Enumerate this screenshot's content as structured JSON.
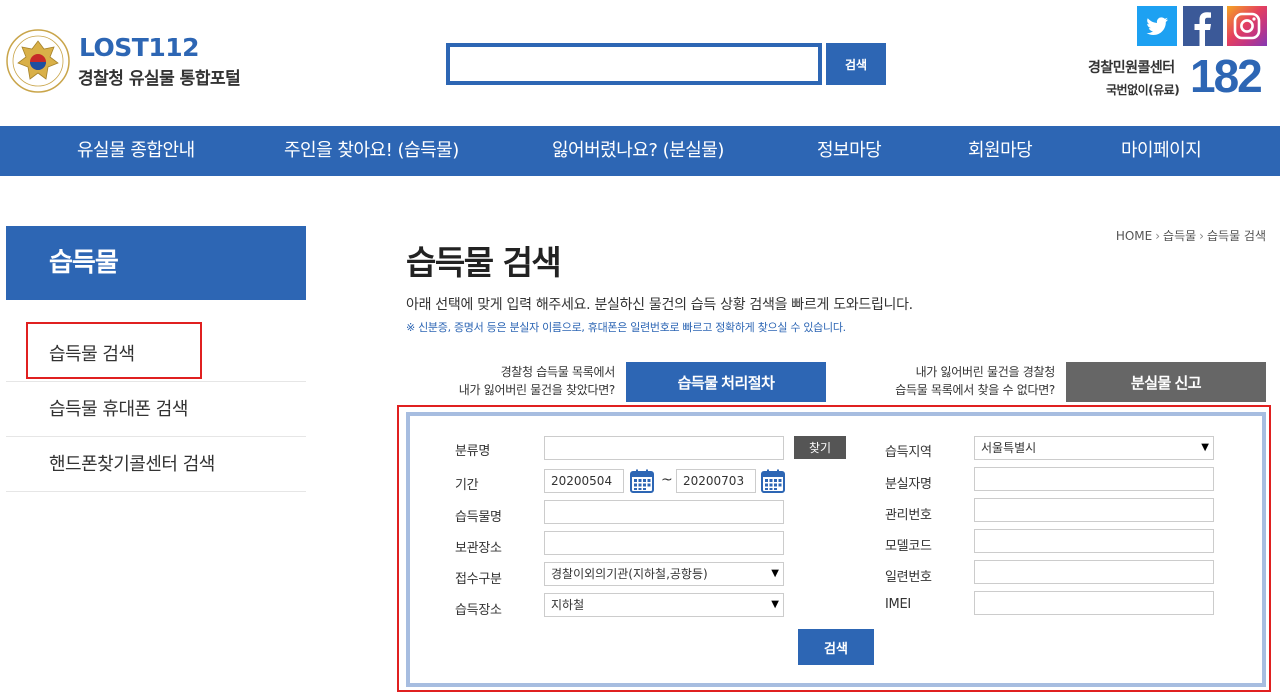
{
  "header": {
    "logo_title": "LOST112",
    "logo_subtitle": "경찰청 유실물 통합포털",
    "search_button": "검색",
    "search_value": "",
    "callcenter_label": "경찰민원콜센터",
    "callcenter_note": "국번없이(유료)",
    "callcenter_number": "182"
  },
  "nav": [
    "유실물 종합안내",
    "주인을 찾아요! (습득물)",
    "잃어버렸나요? (분실물)",
    "정보마당",
    "회원마당",
    "마이페이지"
  ],
  "sidebar": {
    "title": "습득물",
    "items": [
      "습득물 검색",
      "습득물 휴대폰 검색",
      "핸드폰찾기콜센터 검색"
    ]
  },
  "breadcrumb": [
    "HOME",
    "습득물",
    "습득물 검색"
  ],
  "page": {
    "title": "습득물 검색",
    "desc": "아래 선택에 맞게 입력 해주세요. 분실하신 물건의 습득 상황 검색을 빠르게 도와드립니다.",
    "note": "※ 신분증, 증명서 등은 분실자 이름으로, 휴대폰은 일련번호로 빠르고 정확하게 찾으실 수 있습니다."
  },
  "promo": {
    "left_line1": "경찰청 습득물 목록에서",
    "left_line2": "내가 잃어버린 물건을 찾았다면?",
    "left_button": "습득물 처리절차",
    "right_line1": "내가 잃어버린 물건을 경찰청",
    "right_line2": "습득물 목록에서 찾을 수 없다면?",
    "right_button": "분실물 신고"
  },
  "form": {
    "category_label": "분류명",
    "category_value": "",
    "find_button": "찾기",
    "period_label": "기간",
    "date_from": "20200504",
    "date_to": "20200703",
    "tilde": "~",
    "item_name_label": "습득물명",
    "item_name_value": "",
    "storage_label": "보관장소",
    "storage_value": "",
    "receipt_type_label": "접수구분",
    "receipt_type_value": "경찰이외의기관(지하철,공항등)",
    "found_place_label": "습득장소",
    "found_place_value": "지하철",
    "region_label": "습득지역",
    "region_value": "서울특별시",
    "owner_name_label": "분실자명",
    "owner_name_value": "",
    "manage_no_label": "관리번호",
    "manage_no_value": "",
    "model_code_label": "모델코드",
    "model_code_value": "",
    "serial_label": "일련번호",
    "serial_value": "",
    "imei_label": "IMEI",
    "imei_value": "",
    "submit_button": "검색"
  },
  "colors": {
    "primary": "#2d66b4",
    "highlight": "#e02020",
    "form_border": "#a7bde0",
    "gray_button": "#666666"
  },
  "icons": [
    "police-emblem-logo",
    "twitter-icon",
    "facebook-icon",
    "instagram-icon",
    "calendar-icon",
    "select-arrow-icon"
  ]
}
